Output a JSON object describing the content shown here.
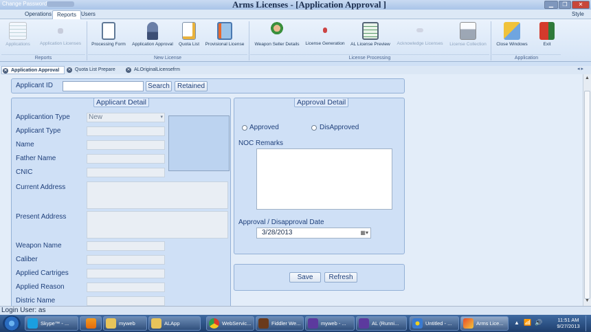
{
  "window": {
    "title": "Arms Licenses - [Application Approval ]",
    "change_password": "Change Password"
  },
  "menu_tabs": [
    "Operations",
    "Reports",
    "Users"
  ],
  "style_label": "Style",
  "ribbon": {
    "buttons": [
      "Applications",
      "Application Licenses",
      "Processing Form",
      "Application Approval",
      "Quota List",
      "Provisional License",
      "Weapon Seller Details",
      "License Generation",
      "AL License Preview",
      "Acknowledge Licenses",
      "License Collection",
      "Close Windows",
      "Exit"
    ],
    "groups": [
      "Reports",
      "New License",
      "License Processing",
      "Application"
    ]
  },
  "doc_tabs": [
    "Application Approval",
    "Quota List Prepare",
    "ALOriginalLicensefrm"
  ],
  "search": {
    "label": "Applicant ID",
    "value": "",
    "search_button": "Search",
    "retained_button": "Retained"
  },
  "applicant_detail": {
    "title": "Applicant  Detail",
    "labels": [
      "Applicantion Type",
      "Applicant Type",
      "Name",
      "Father Name",
      "CNIC",
      "Current Address",
      "Present Address",
      "Weapon Name",
      "Caliber",
      "Applied Cartriges",
      "Applied Reason",
      "Distric Name"
    ],
    "application_type_value": "New"
  },
  "approval_detail": {
    "title": "Approval Detail",
    "approved_label": "Approved",
    "disapproved_label": "DisApproved",
    "noc_label": "NOC Remarks",
    "date_label": "Approval / Disapproval Date",
    "date_value": "3/28/2013"
  },
  "actions": {
    "save": "Save",
    "refresh": "Refresh"
  },
  "status_bar": "Login User: as",
  "taskbar": {
    "items": [
      "Skype™ - ...",
      "",
      "myweb",
      "ALApp",
      "WebServic...",
      "Fiddler We...",
      "myweb - ...",
      "AL (Runni...",
      "Untitled - ...",
      "Arms Lice..."
    ],
    "time": "11:51 AM",
    "date": "9/27/2013"
  },
  "colors": {
    "accent": "#1e3f7a",
    "panel": "#cfe0f6",
    "taskbar": "#1e3e6d"
  }
}
